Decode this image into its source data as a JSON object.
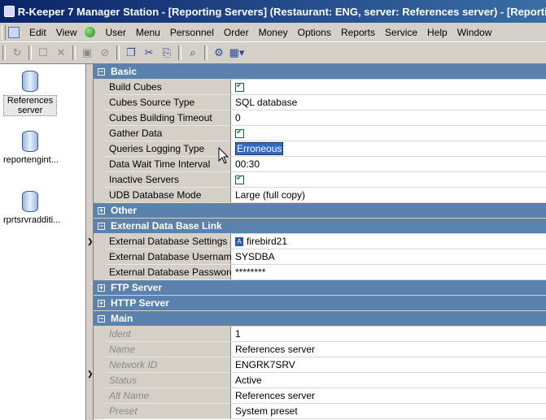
{
  "window": {
    "title": "R-Keeper 7 Manager Station - [Reporting Servers] (Restaurant: ENG, server: References server) - [Reporting Servers]"
  },
  "menu": {
    "items": [
      "Edit",
      "View",
      "User",
      "Menu",
      "Personnel",
      "Order",
      "Money",
      "Options",
      "Reports",
      "Service",
      "Help",
      "Window"
    ]
  },
  "toolbar": {
    "icons": [
      "refresh-icon",
      "new-icon",
      "delete-icon",
      "save-icon",
      "cancel-icon",
      "copy-icon",
      "cut-icon",
      "paste-icon",
      "find-icon",
      "properties-icon",
      "view-toggle-icon"
    ]
  },
  "servers": [
    {
      "label": "References server",
      "selected": true
    },
    {
      "label": "reportengint...",
      "selected": false
    },
    {
      "label": "rprtsrvradditi...",
      "selected": false
    }
  ],
  "categories": {
    "basic": "Basic",
    "other": "Other",
    "external_db": "External Data Base Link",
    "ftp": "FTP Server",
    "http": "HTTP Server",
    "main": "Main"
  },
  "props": {
    "build_cubes": {
      "name": "Build Cubes",
      "checked": true
    },
    "cubes_source_type": {
      "name": "Cubes Source Type",
      "value": "SQL database"
    },
    "cubes_building_timeout": {
      "name": "Cubes Building Timeout",
      "value": "0"
    },
    "gather_data": {
      "name": "Gather Data",
      "checked": true
    },
    "queries_logging_type": {
      "name": "Queries Logging Type",
      "value": "Erroneous"
    },
    "data_wait_time": {
      "name": "Data Wait Time Interval",
      "value": "00:30"
    },
    "inactive_servers": {
      "name": "Inactive Servers",
      "checked": true
    },
    "udb_mode": {
      "name": "UDB Database Mode",
      "value": "Large (full copy)"
    },
    "ext_settings": {
      "name": "External Database Settings",
      "value": "firebird21"
    },
    "ext_username": {
      "name": "External Database Username",
      "value": "SYSDBA"
    },
    "ext_password": {
      "name": "External Database Password",
      "value": "********"
    },
    "ident": {
      "name": "Ident",
      "value": "1"
    },
    "name": {
      "name": "Name",
      "value": "References server"
    },
    "network_id": {
      "name": "Network ID",
      "value": "ENGRK7SRV"
    },
    "status": {
      "name": "Status",
      "value": "Active"
    },
    "alt_name": {
      "name": "Alt Name",
      "value": "References server"
    },
    "preset": {
      "name": "Preset",
      "value": "System preset"
    }
  },
  "colors": {
    "category_bg": "#5a82ac",
    "title_bg": "#0a246a",
    "selection": "#316ac5"
  }
}
